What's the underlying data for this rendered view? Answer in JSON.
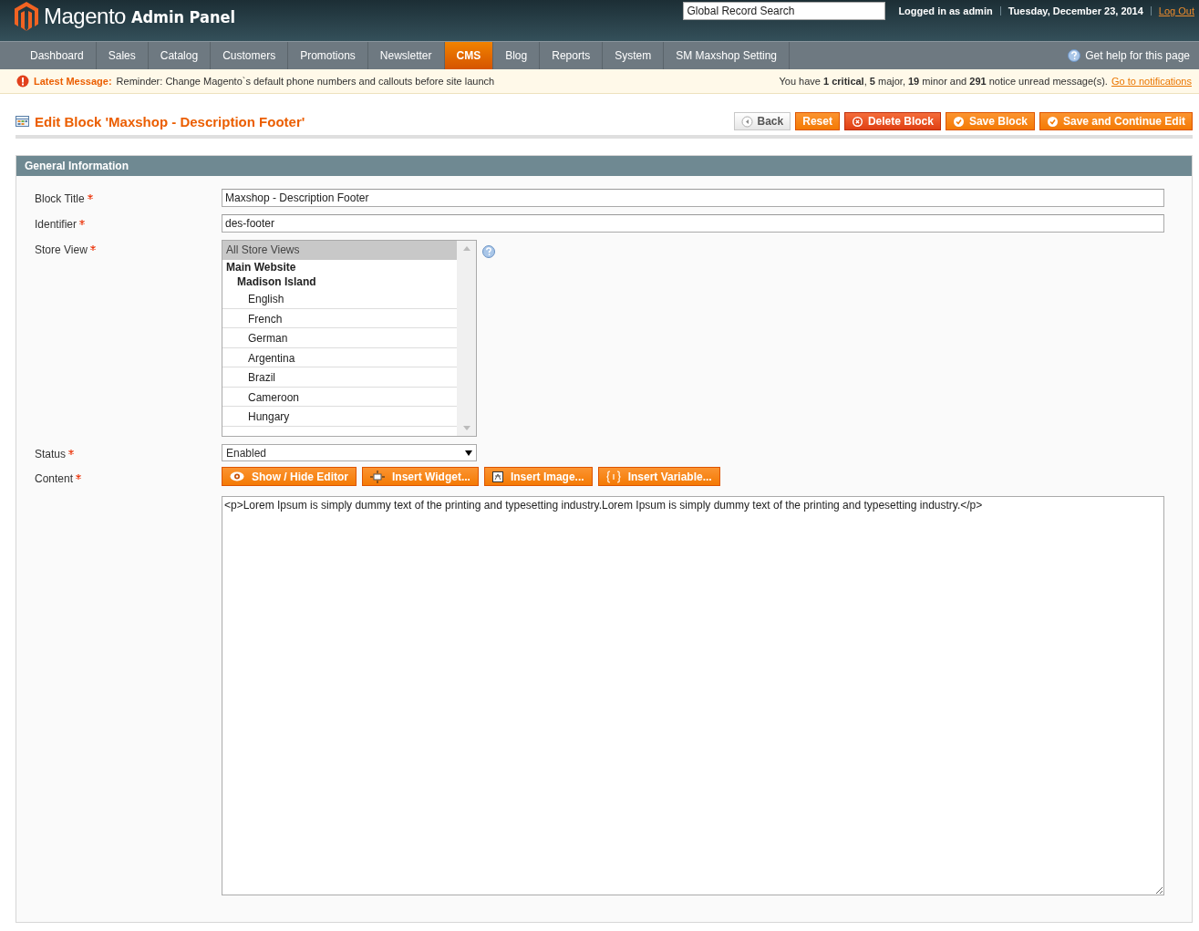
{
  "header": {
    "logo_word": "Magento",
    "logo_suffix": "Admin Panel",
    "search": {
      "placeholder": "Global Record Search"
    },
    "user": "Logged in as admin",
    "date": "Tuesday, December 23, 2014",
    "logout": "Log Out"
  },
  "nav": {
    "items": [
      {
        "label": "Dashboard",
        "selected": false
      },
      {
        "label": "Sales",
        "selected": false
      },
      {
        "label": "Catalog",
        "selected": false
      },
      {
        "label": "Customers",
        "selected": false
      },
      {
        "label": "Promotions",
        "selected": false
      },
      {
        "label": "Newsletter",
        "selected": false
      },
      {
        "label": "CMS",
        "selected": true
      },
      {
        "label": "Blog",
        "selected": false
      },
      {
        "label": "Reports",
        "selected": false
      },
      {
        "label": "System",
        "selected": false
      },
      {
        "label": "SM Maxshop Setting",
        "selected": false
      }
    ],
    "help": "Get help for this page"
  },
  "message": {
    "label": "Latest Message:",
    "text": "Reminder: Change Magento`s default phone numbers and callouts before site launch",
    "summary": "You have **1 critical**, **5** major, **19** minor and **291** notice unread message(s).",
    "link": "Go to notifications"
  },
  "page": {
    "title": "Edit Block 'Maxshop - Description Footer'",
    "buttons": [
      {
        "kind": "back",
        "label": "Back"
      },
      {
        "kind": "plain",
        "label": "Reset"
      },
      {
        "kind": "delete",
        "label": "Delete Block"
      },
      {
        "kind": "save",
        "label": "Save Block"
      },
      {
        "kind": "save",
        "label": "Save and Continue Edit"
      }
    ]
  },
  "form": {
    "section": "General Information",
    "fields": [
      {
        "kind": "text",
        "label": "Block Title",
        "required": true,
        "value": "Maxshop - Description Footer"
      },
      {
        "kind": "text",
        "label": "Identifier",
        "required": true,
        "value": "des-footer"
      },
      {
        "kind": "multiselect",
        "label": "Store View",
        "required": true,
        "options": [
          {
            "label": "All Store Views",
            "selected": true
          },
          {
            "label": "Main Website",
            "selected": false,
            "children": [
              {
                "label": "Madison Island",
                "selected": false,
                "children": [
                  {
                    "label": "English",
                    "selected": false
                  },
                  {
                    "label": "French",
                    "selected": false
                  },
                  {
                    "label": "German",
                    "selected": false
                  },
                  {
                    "label": "Argentina",
                    "selected": false
                  },
                  {
                    "label": "Brazil",
                    "selected": false
                  },
                  {
                    "label": "Cameroon",
                    "selected": false
                  },
                  {
                    "label": "Hungary",
                    "selected": false
                  }
                ]
              }
            ]
          }
        ]
      },
      {
        "kind": "select",
        "label": "Status",
        "required": true,
        "value": "Enabled"
      },
      {
        "kind": "editor",
        "label": "Content",
        "required": true,
        "buttons": [
          {
            "kind": "eye",
            "label": "Show / Hide Editor"
          },
          {
            "kind": "widget",
            "label": "Insert Widget..."
          },
          {
            "kind": "image",
            "label": "Insert Image..."
          },
          {
            "kind": "variable",
            "label": "Insert Variable..."
          }
        ],
        "value": "<p>Lorem Ipsum is simply dummy text of the printing and typesetting industry.Lorem Ipsum is simply dummy text of the printing and typesetting industry.</p>"
      }
    ]
  }
}
